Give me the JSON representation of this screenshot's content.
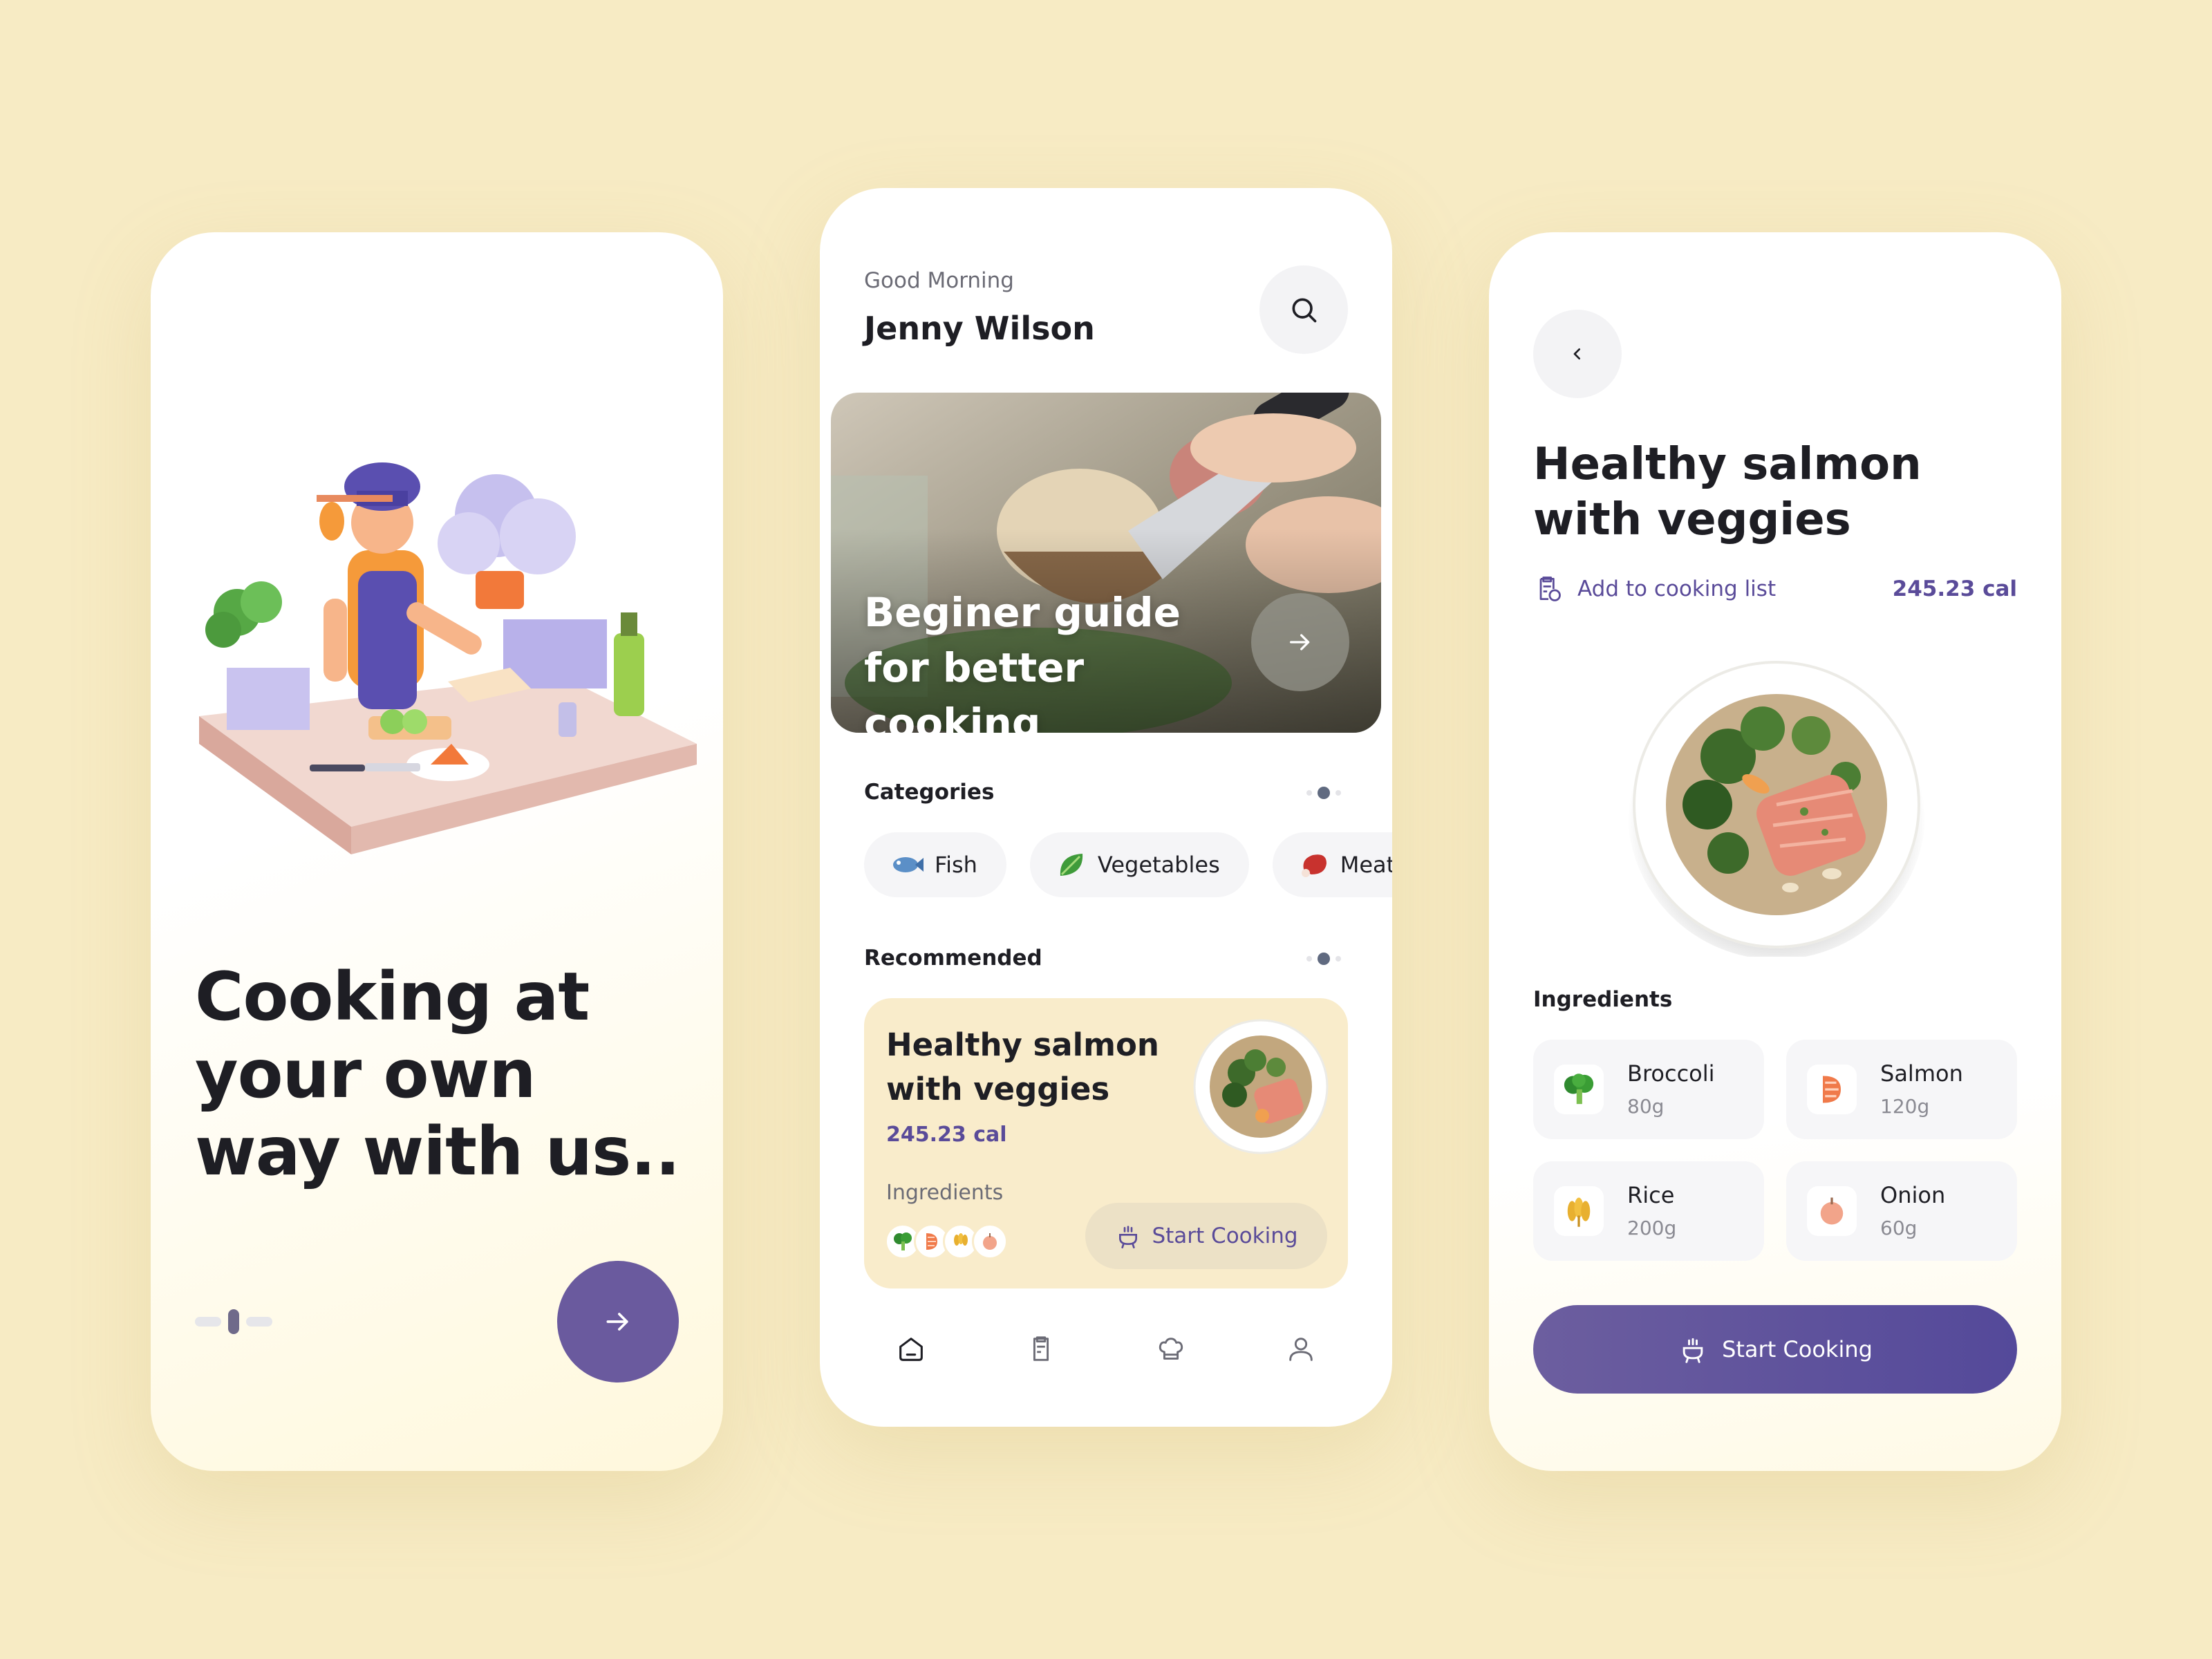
{
  "onboarding": {
    "headline": "Cooking at your own way with us..",
    "next_icon": "arrow-right-icon"
  },
  "home": {
    "greeting": "Good Morning",
    "user_name": "Jenny Wilson",
    "search_icon": "search-icon",
    "hero": {
      "title": "Beginer guide for better cooking",
      "arrow_icon": "arrow-right-icon"
    },
    "categories": {
      "title": "Categories",
      "items": [
        {
          "label": "Fish",
          "icon": "fish-icon"
        },
        {
          "label": "Vegetables",
          "icon": "leaf-icon"
        },
        {
          "label": "Meat",
          "icon": "meat-icon"
        }
      ]
    },
    "recommended": {
      "title": "Recommended",
      "card": {
        "title": "Healthy salmon with veggies",
        "calories": "245.23 cal",
        "ingredients_label": "Ingredients",
        "start_label": "Start Cooking"
      }
    },
    "tabbar": [
      "home-icon",
      "cooking-list-icon",
      "chef-hat-icon",
      "profile-icon"
    ]
  },
  "detail": {
    "back_icon": "chevron-left-icon",
    "title": "Healthy salmon with veggies",
    "add_list_label": "Add to cooking list",
    "calories": "245.23 cal",
    "ingredients_title": "Ingredients",
    "ingredients": [
      {
        "name": "Broccoli",
        "qty": "80g",
        "icon": "broccoli-icon"
      },
      {
        "name": "Salmon",
        "qty": "120g",
        "icon": "salmon-icon"
      },
      {
        "name": "Rice",
        "qty": "200g",
        "icon": "rice-icon"
      },
      {
        "name": "Onion",
        "qty": "60g",
        "icon": "onion-icon"
      }
    ],
    "start_label": "Start Cooking"
  },
  "colors": {
    "background": "#f7ebc4",
    "accent": "#5a4b99",
    "card": "#f9eccb"
  }
}
